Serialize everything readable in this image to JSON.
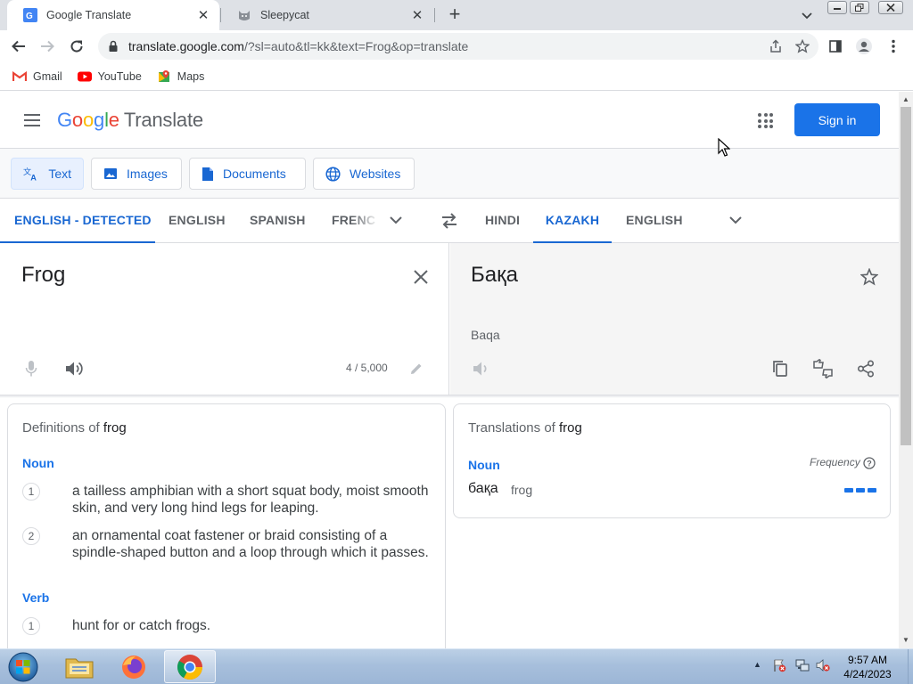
{
  "browser": {
    "tabs": [
      {
        "title": "Google Translate",
        "favicon": "google-translate-favicon",
        "active": true
      },
      {
        "title": "Sleepycat",
        "favicon": "cat-favicon",
        "active": false
      }
    ],
    "url_host": "translate.google.com",
    "url_rest": "/?sl=auto&tl=kk&text=Frog&op=translate",
    "bookmarks": [
      {
        "label": "Gmail",
        "icon": "gmail-icon"
      },
      {
        "label": "YouTube",
        "icon": "youtube-icon"
      },
      {
        "label": "Maps",
        "icon": "maps-icon"
      }
    ]
  },
  "header": {
    "logo": {
      "g1": "G",
      "g2": "o",
      "g3": "o",
      "g4": "g",
      "g5": "l",
      "g6": "e"
    },
    "product": "Translate",
    "signin_label": "Sign in"
  },
  "modes": [
    {
      "label": "Text",
      "icon": "translate-icon"
    },
    {
      "label": "Images",
      "icon": "image-icon"
    },
    {
      "label": "Documents",
      "icon": "document-icon"
    },
    {
      "label": "Websites",
      "icon": "globe-icon"
    }
  ],
  "source_langs": [
    "ENGLISH - DETECTED",
    "ENGLISH",
    "SPANISH",
    "FRENC"
  ],
  "target_langs": [
    "HINDI",
    "KAZAKH",
    "ENGLISH"
  ],
  "source": {
    "text": "Frog",
    "counter": "4 / 5,000"
  },
  "target": {
    "text": "Бақа",
    "transliteration": "Baqa"
  },
  "definitions": {
    "title_prefix": "Definitions of",
    "word": "frog",
    "groups": [
      {
        "pos": "Noun",
        "items": [
          {
            "n": "1",
            "text": "a tailless amphibian with a short squat body, moist smooth skin, and very long hind legs for leaping."
          },
          {
            "n": "2",
            "text": "an ornamental coat fastener or braid consisting of a spindle-shaped button and a loop through which it passes."
          }
        ]
      },
      {
        "pos": "Verb",
        "items": [
          {
            "n": "1",
            "text": "hunt for or catch frogs."
          }
        ]
      }
    ]
  },
  "translations": {
    "title_prefix": "Translations of",
    "word": "frog",
    "pos": "Noun",
    "frequency_label": "Frequency",
    "frequency_level": 3,
    "frequency_max": 3,
    "entries": [
      {
        "word": "бақа",
        "back": "frog"
      }
    ]
  },
  "taskbar": {
    "apps": [
      "file-explorer-icon",
      "firefox-icon",
      "chrome-icon"
    ],
    "time": "9:57 AM",
    "date": "4/24/2023"
  },
  "colors": {
    "accent": "#1a73e8",
    "active_lang": "#1967d2",
    "target_panel": "#f5f5f5"
  }
}
